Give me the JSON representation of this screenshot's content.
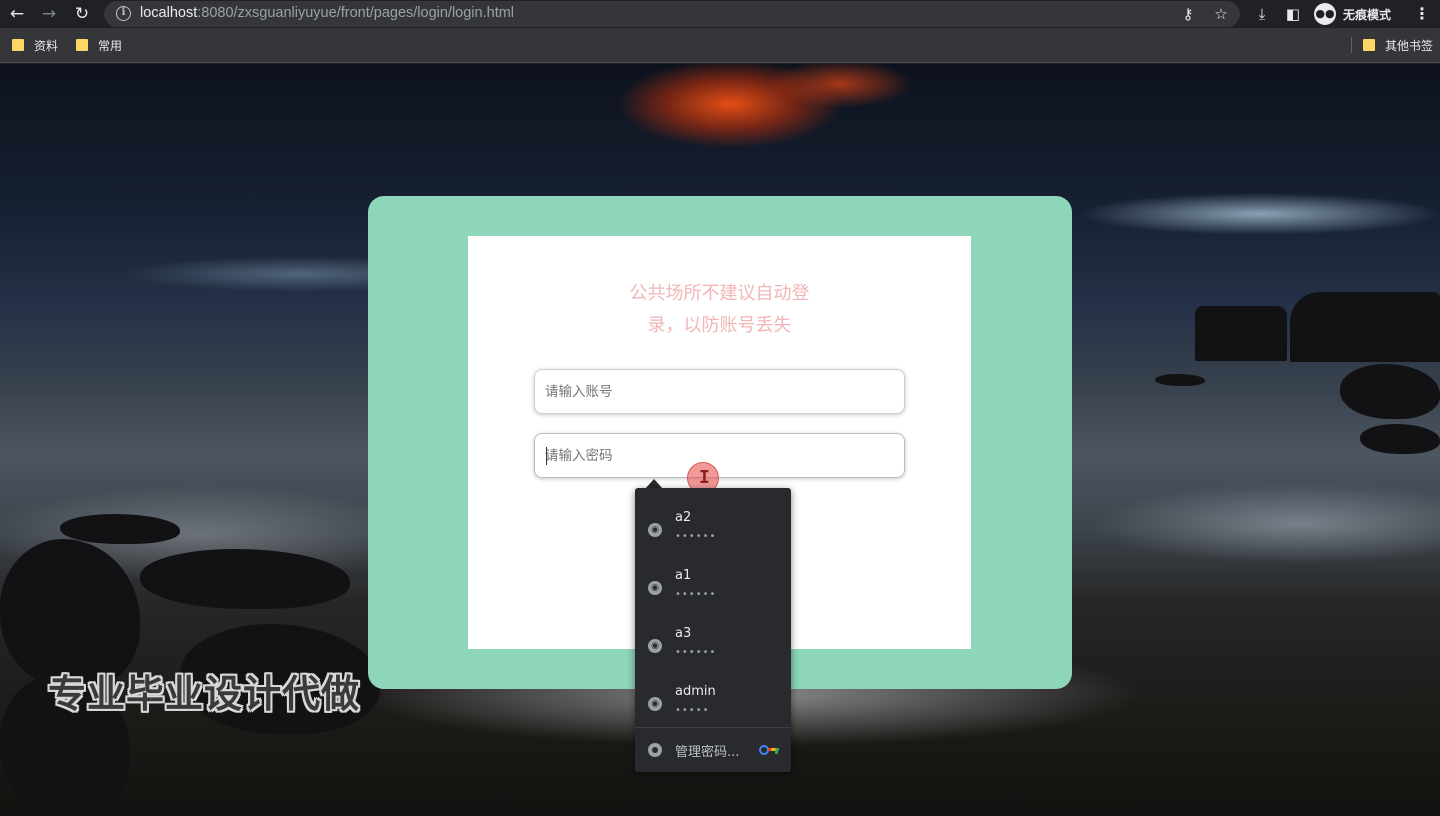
{
  "browser": {
    "url_host": "localhost",
    "url_path": ":8080/zxsguanliyuyue/front/pages/login/login.html",
    "incognito_label": "无痕模式",
    "icons": {
      "back": "arrow-left-icon",
      "forward": "arrow-right-icon",
      "reload": "reload-icon",
      "info": "info-icon",
      "key": "key-icon",
      "bookmark": "star-icon",
      "download": "download-icon",
      "sidepanel": "side-panel-icon",
      "menu": "kebab-menu-icon"
    }
  },
  "bookmarks": {
    "items": [
      "资料",
      "常用"
    ],
    "other": "其他书签"
  },
  "login": {
    "notice_line1": "公共场所不建议自动登",
    "notice_line2": "录，以防账号丢失",
    "account_placeholder": "请输入账号",
    "password_placeholder": "请输入密码"
  },
  "watermark": "专业毕业设计代做",
  "password_dropdown": {
    "credentials": [
      {
        "username": "a2",
        "masked": "••••••"
      },
      {
        "username": "a1",
        "masked": "••••••"
      },
      {
        "username": "a3",
        "masked": "••••••"
      },
      {
        "username": "admin",
        "masked": "•••••"
      }
    ],
    "manage_label": "管理密码..."
  },
  "colors": {
    "card_bg": "#8ed6b9",
    "notice_text": "#f2b6b6",
    "chrome_bg": "#202124",
    "dropdown_bg": "#292a2d"
  }
}
